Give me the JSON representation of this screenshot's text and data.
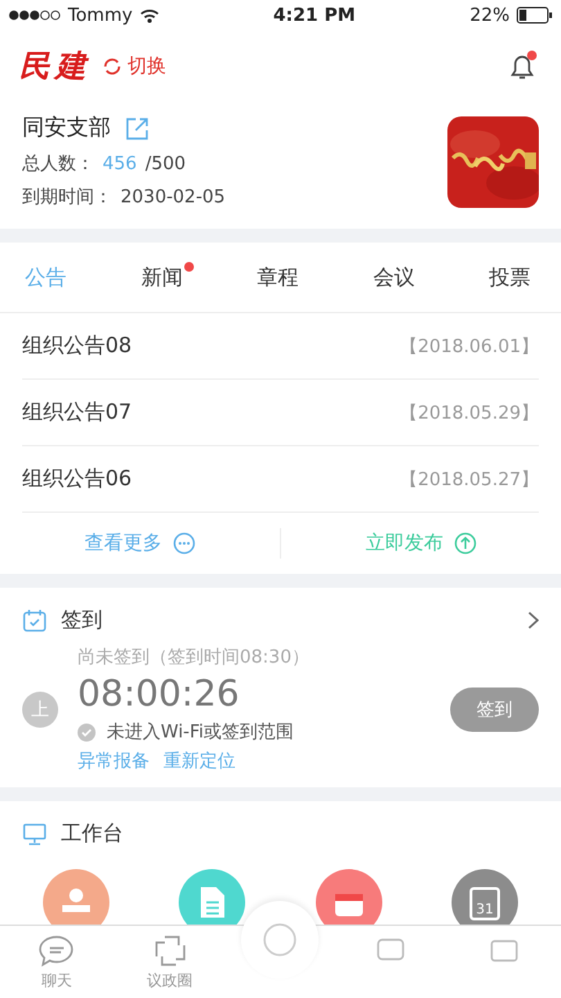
{
  "status_bar": {
    "carrier": "Tommy",
    "time": "4:21 PM",
    "battery": "22%"
  },
  "header": {
    "logo": "民建",
    "switch_label": "切换",
    "notifications": {
      "unread": true
    }
  },
  "org": {
    "name": "同安支部",
    "members_label": "总人数：",
    "members": "456",
    "members_total": "/500",
    "expiry_label": "到期时间：",
    "expiry": "2030-02-05"
  },
  "tabs": [
    {
      "label": "公告",
      "selected": true,
      "badge": false
    },
    {
      "label": "新闻",
      "selected": false,
      "badge": true
    },
    {
      "label": "章程",
      "selected": false,
      "badge": false
    },
    {
      "label": "会议",
      "selected": false,
      "badge": false
    },
    {
      "label": "投票",
      "selected": false,
      "badge": false
    }
  ],
  "notices": [
    {
      "title": "组织公告08",
      "date": "【2018.06.01】"
    },
    {
      "title": "组织公告07",
      "date": "【2018.05.29】"
    },
    {
      "title": "组织公告06",
      "date": "【2018.05.27】"
    }
  ],
  "actions": [
    {
      "label": "查看更多",
      "kind": "more"
    },
    {
      "label": "立即发布",
      "kind": "publish"
    }
  ],
  "checkin": {
    "title": "签到",
    "status": "尚未签到（签到时间08:30）",
    "period": "上",
    "time": "08:00:26",
    "location_note": "未进入Wi-Fi或签到范围",
    "links": [
      "异常报备",
      "重新定位"
    ],
    "button": {
      "label": "签到",
      "disabled": true
    }
  },
  "workbench": {
    "title": "工作台",
    "apps": [
      {
        "kind": "stamp",
        "color": "#f4a98a"
      },
      {
        "kind": "document",
        "color": "#4fd8cf"
      },
      {
        "kind": "briefcase",
        "color": "#f77b7b"
      },
      {
        "kind": "calendar",
        "color": "#8c8c8c",
        "day": "31"
      }
    ]
  },
  "tab_bar": [
    {
      "kind": "chat",
      "label": "聊天"
    },
    {
      "kind": "circle",
      "label": "议政圈"
    },
    {
      "kind": "center"
    },
    {
      "kind": "grid"
    },
    {
      "kind": "profile"
    }
  ]
}
